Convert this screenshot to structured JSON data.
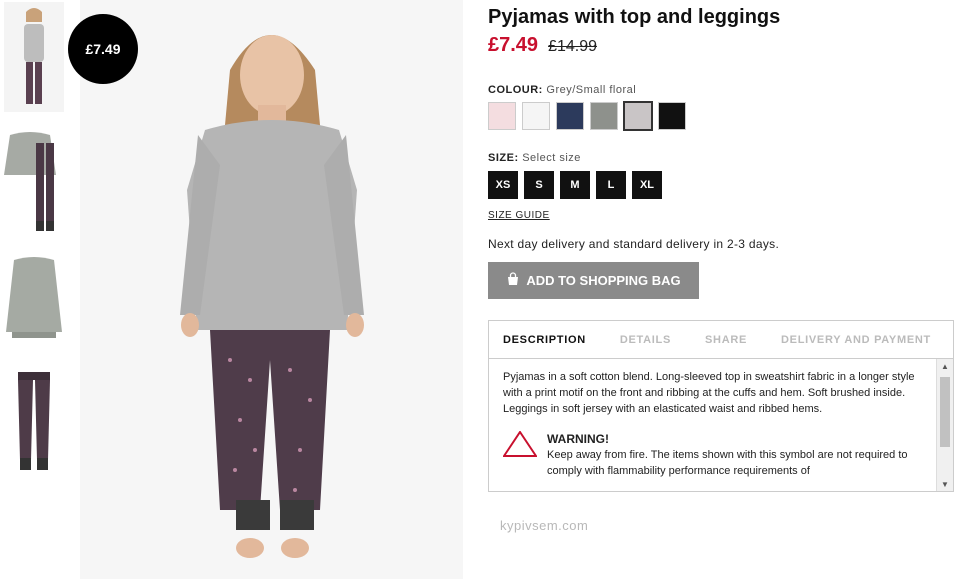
{
  "product": {
    "title": "Pyjamas with top and leggings",
    "price_now": "£7.49",
    "price_old": "£14.99",
    "badge": "£7.49"
  },
  "colour": {
    "label": "COLOUR:",
    "value": "Grey/Small floral",
    "swatches": [
      "#f4dde0",
      "#f5f5f5",
      "#2c3a5c",
      "#8e918c",
      "#c9c5c6",
      "#111111"
    ],
    "selected_index": 4
  },
  "size": {
    "label": "SIZE:",
    "value": "Select size",
    "options": [
      "XS",
      "S",
      "M",
      "L",
      "XL"
    ],
    "guide": "SIZE GUIDE"
  },
  "delivery": "Next day delivery and standard delivery in 2-3 days.",
  "cart": {
    "add_label": "ADD TO SHOPPING BAG"
  },
  "tabs": [
    "DESCRIPTION",
    "DETAILS",
    "SHARE",
    "DELIVERY AND PAYMENT"
  ],
  "description": {
    "text": "Pyjamas in a soft cotton blend. Long-sleeved top in sweatshirt fabric in a longer style with a print motif on the front and ribbing at the cuffs and hem. Soft brushed inside. Leggings in soft jersey with an elasticated waist and ribbed hems.",
    "warning_title": "WARNING!",
    "warning_text": "Keep away from fire. The items shown with this symbol are not required to comply with flammability performance requirements of"
  },
  "watermark": "kypivsem.com",
  "icons": {
    "bag": "shopping-bag-icon",
    "warning": "keep-away-from-fire-icon",
    "scroll_up": "chevron-up-icon",
    "scroll_down": "chevron-down-icon"
  }
}
